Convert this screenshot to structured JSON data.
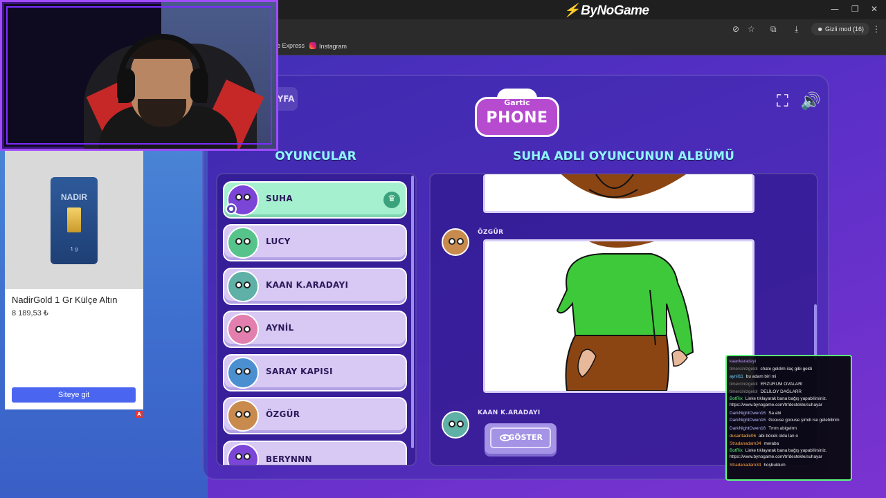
{
  "browser": {
    "brand": "ByNoGame",
    "bookmarks": [
      "e Express",
      "Instagram"
    ],
    "incognito_label": "Gizli mod (16)"
  },
  "ad": {
    "product_title": "NadirGold 1 Gr Külçe Altın",
    "price": "8 189,53 ₺",
    "cta": "Siteye git",
    "badge": "A",
    "packaging_brand": "NADIR",
    "packaging_weight": "1 g"
  },
  "game": {
    "logo_top": "Gartic",
    "logo_bottom": "PHONE",
    "corner_tab": "YFA",
    "players_heading": "OYUNCULAR",
    "album_heading": "SUHA ADLI OYUNCUNUN ALBÜMÜ",
    "players": [
      {
        "name": "SUHA",
        "host": true,
        "color": "#7b45d8"
      },
      {
        "name": "LUCY",
        "host": false,
        "color": "#56c48a"
      },
      {
        "name": "KAAN K.ARADAYI",
        "host": false,
        "color": "#5fb0a6"
      },
      {
        "name": "AYNİL",
        "host": false,
        "color": "#e27fae"
      },
      {
        "name": "SARAY KAPISI",
        "host": false,
        "color": "#4a8fd0"
      },
      {
        "name": "ÖZGÜR",
        "host": false,
        "color": "#c98a4e"
      },
      {
        "name": "BERYNNN",
        "host": false,
        "color": "#7b45d8"
      }
    ],
    "album": {
      "entries": [
        {
          "author": "ÖZGÜR"
        },
        {
          "author": "KAAN K.ARADAYI"
        }
      ],
      "show_button": "GÖSTER"
    }
  },
  "chat": {
    "messages": [
      {
        "user": "kaankaradayi",
        "text": "",
        "color": "#b98cff"
      },
      {
        "user": "timercinizgeldi",
        "text": "chate geldim ilaç gibi geldi",
        "color": "#8a8a8a"
      },
      {
        "user": "aynil11",
        "text": "bu adam biri mi",
        "color": "#6bd1ff"
      },
      {
        "user": "timercinizgeldi",
        "text": "ERZURUM OVALARI",
        "color": "#8a8a8a"
      },
      {
        "user": "timercinizgeldi",
        "text": "DELİLOY DAĞLARR",
        "color": "#8a8a8a"
      },
      {
        "user": "BotRix",
        "text": "Linke tıklayarak bana bağış yapabilirsiniz. https://www.bynogame.com/tr/destekle/suhayar",
        "color": "#5cff7a",
        "wrap": true
      },
      {
        "user": "DarkNightOwen16",
        "text": "Sa abi",
        "color": "#b8b8ff"
      },
      {
        "user": "DarkNightOwen16",
        "text": "Goouse goouse şimdi ise gelebilirim",
        "color": "#b8b8ff",
        "wrap": true
      },
      {
        "user": "DarkNightOwen16",
        "text": "Tmm abigelrm",
        "color": "#b8b8ff"
      },
      {
        "user": "dusantadic06",
        "text": "abi böcek oldu lan o",
        "color": "#ffb347"
      },
      {
        "user": "Stradanadam34",
        "text": "meraba",
        "color": "#ff9f43"
      },
      {
        "user": "BotRix",
        "text": "Linke tıklayarak bana bağış yapabilirsiniz. https://www.bynogame.com/tr/destekle/suhayar",
        "color": "#5cff7a",
        "wrap": true
      },
      {
        "user": "Stradanadam34",
        "text": "hoşbuldum",
        "color": "#ff9f43"
      }
    ]
  },
  "colors": {
    "accent": "#8ff5ff",
    "page_purple": "#5a2fc8",
    "chat_border": "#5cff7a",
    "cam_frame": "#a14bff"
  }
}
